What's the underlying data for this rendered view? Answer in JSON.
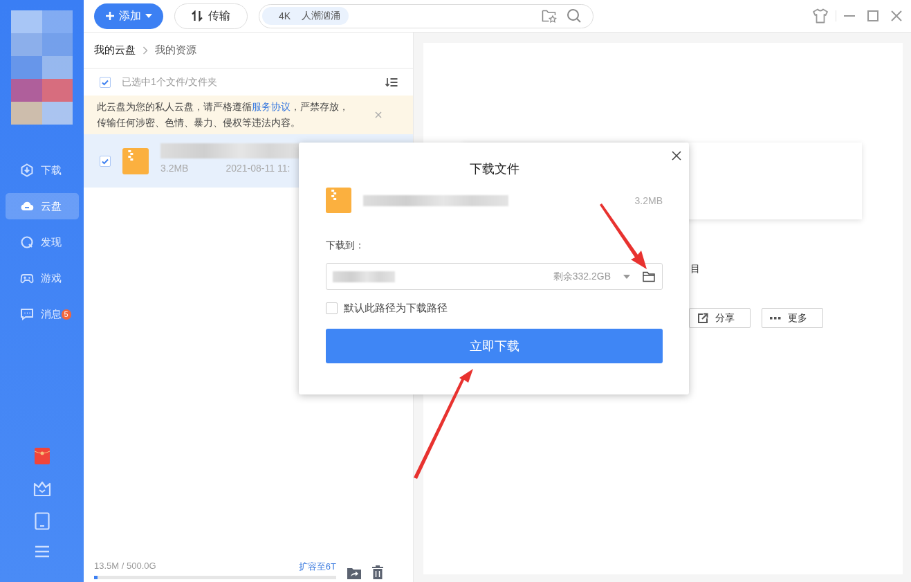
{
  "sidebar": {
    "nav": [
      {
        "label": "下载",
        "kind": "download",
        "selected": false
      },
      {
        "label": "云盘",
        "kind": "cloud",
        "selected": true
      },
      {
        "label": "发现",
        "kind": "discover",
        "selected": false
      },
      {
        "label": "游戏",
        "kind": "game",
        "selected": false
      },
      {
        "label": "消息",
        "kind": "message",
        "selected": false,
        "badge": "5"
      }
    ]
  },
  "topbar": {
    "add_button": "添加",
    "transfer_button": "传输",
    "search_tags": [
      "4K",
      "人潮汹涌"
    ]
  },
  "breadcrumb": [
    "我的云盘",
    "我的资源"
  ],
  "selection": {
    "checked": true,
    "label": "已选中1个文件/文件夹"
  },
  "notice": {
    "text_before": "此云盘为您的私人云盘，请严格遵循",
    "link": "服务协议",
    "text_after": "，严禁存放，传输任何涉密、色情、暴力、侵权等违法内容。"
  },
  "files": [
    {
      "checked": true,
      "selected": true,
      "size": "3.2MB",
      "date": "2021-08-11 11:"
    }
  ],
  "storage": {
    "usage": "13.5M / 500.0G",
    "upgrade_link": "扩容至6T",
    "level": 0.015
  },
  "details": {
    "text_fragment": "目",
    "buttons": [
      {
        "label": "分享",
        "kind": "share"
      },
      {
        "label": "更多",
        "kind": "more"
      }
    ]
  },
  "dialog": {
    "title": "下载文件",
    "file_size": "3.2MB",
    "save_to_label": "下载到：",
    "free_space": "剩余332.2GB",
    "default_path": {
      "label": "默认此路径为下载路径",
      "checked": false
    },
    "download_button": "立即下载"
  }
}
